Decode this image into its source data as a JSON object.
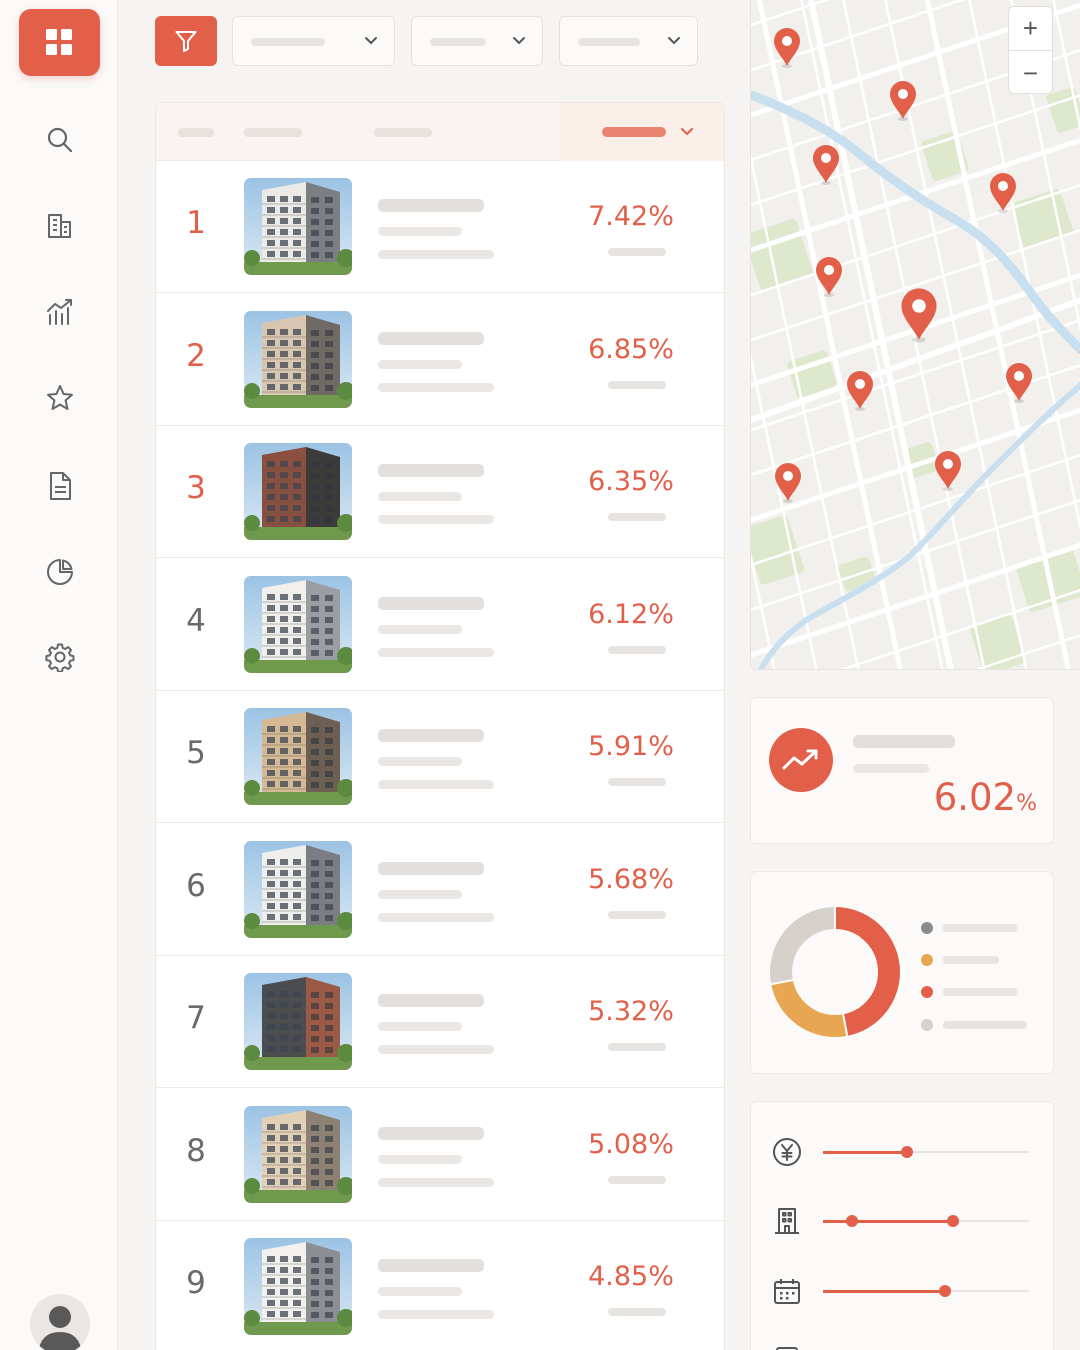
{
  "sidebar": {
    "items": [
      {
        "icon": "search-icon"
      },
      {
        "icon": "building-icon"
      },
      {
        "icon": "analytics-icon"
      },
      {
        "icon": "star-icon"
      },
      {
        "icon": "document-icon"
      },
      {
        "icon": "pie-chart-icon"
      },
      {
        "icon": "gear-icon"
      }
    ]
  },
  "toolbar": {
    "filter_icon": "funnel-icon"
  },
  "listings": [
    {
      "rank": "1",
      "yield": "7.42%"
    },
    {
      "rank": "2",
      "yield": "6.85%"
    },
    {
      "rank": "3",
      "yield": "6.35%"
    },
    {
      "rank": "4",
      "yield": "6.12%"
    },
    {
      "rank": "5",
      "yield": "5.91%"
    },
    {
      "rank": "6",
      "yield": "5.68%"
    },
    {
      "rank": "7",
      "yield": "5.32%"
    },
    {
      "rank": "8",
      "yield": "5.08%"
    },
    {
      "rank": "9",
      "yield": "4.85%"
    }
  ],
  "map": {
    "zoom_in": "+",
    "zoom_out": "−"
  },
  "kpi": {
    "value": "6.02",
    "unit": "%"
  },
  "filters": {
    "price_level": 0.41,
    "building_range": [
      0.14,
      0.63
    ],
    "date_level": 0.59
  },
  "colors": {
    "accent": "#e2604a",
    "accent_light": "#e9826f",
    "donut_red": "#e2604a",
    "donut_orange": "#e8a552",
    "donut_grey": "#d6d1cb",
    "water": "#c8dff0",
    "park": "#dde8cc"
  },
  "donut_shares": [
    0.47,
    0.25,
    0.28
  ]
}
